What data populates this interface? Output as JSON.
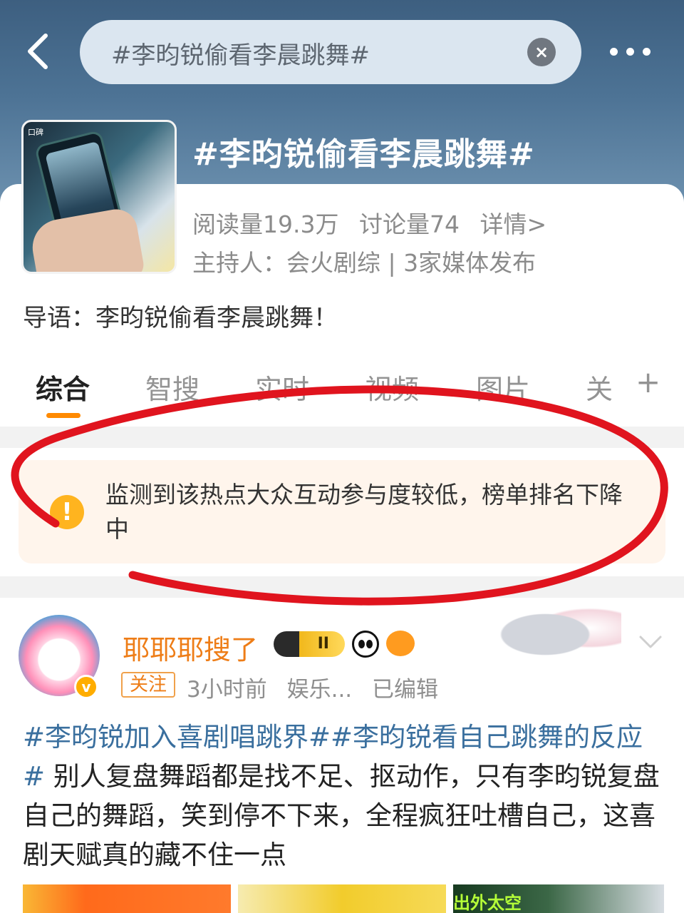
{
  "header": {
    "search_query": "#李昀锐偷看李晨跳舞#",
    "clear_icon": "close-icon",
    "back_icon": "chevron-left-icon",
    "more_icon": "more-horizontal-icon"
  },
  "topic": {
    "title": "#李昀锐偷看李晨跳舞#",
    "thumbnail_caption": "口碑",
    "stats": {
      "reads": "阅读量19.3万",
      "discussions": "讨论量74",
      "details": "详情>"
    },
    "host": "主持人：会火剧综 | 3家媒体发布",
    "intro": "导语：李昀锐偷看李晨跳舞！"
  },
  "tabs": {
    "items": [
      "综合",
      "智搜",
      "实时",
      "视频",
      "图片",
      "关"
    ],
    "active_index": 0,
    "add_label": "+"
  },
  "notice": {
    "icon": "warning-icon",
    "text": "监测到该热点大众互动参与度较低，榜单排名下降中"
  },
  "post": {
    "username": "耶耶耶搜了",
    "badge_level": "II",
    "follow_label": "关注",
    "time": "3小时前",
    "source": "娱乐...",
    "edited": "已编辑",
    "body": {
      "tag1": "#李昀锐加入喜剧唱跳界#",
      "tag2": "#李昀锐看自己跳舞的反应#",
      "text": " 别人复盘舞蹈都是找不足、抠动作，只有李昀锐复盘自己的舞蹈，笑到停不下来，全程疯狂吐槽自己，这喜剧天赋真的藏不住一点"
    },
    "image3_label": "出外太空"
  },
  "colors": {
    "accent_orange": "#ff8a00",
    "link_blue": "#3a6f9e",
    "annotation_red": "#e0141e"
  }
}
